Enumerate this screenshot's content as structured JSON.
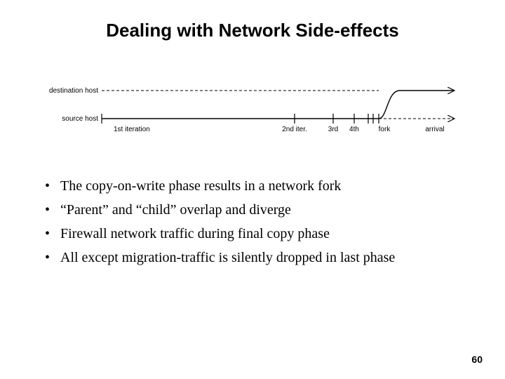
{
  "title": "Dealing with Network Side-effects",
  "diagram": {
    "dest_label": "destination host",
    "src_label": "source host",
    "ticks": {
      "iter1": "1st iteration",
      "iter2": "2nd iter.",
      "iter3": "3rd",
      "iter4": "4th",
      "fork": "fork",
      "arrival": "arrival"
    }
  },
  "bullets": [
    "The copy-on-write phase results in a network fork",
    "“Parent” and “child” overlap and diverge",
    "Firewall network traffic during final copy phase",
    "All except migration-traffic is silently dropped in last phase"
  ],
  "page_number": "60"
}
